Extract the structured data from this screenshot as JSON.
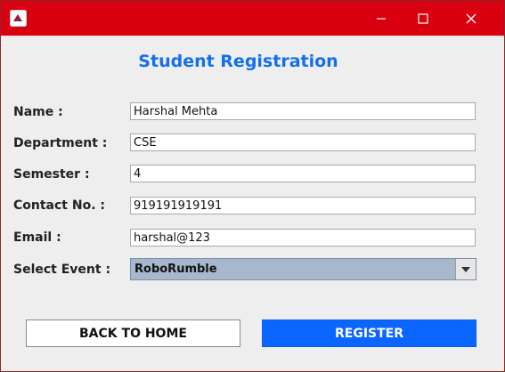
{
  "window": {
    "title_bar_color": "#d9000f",
    "controls": {
      "minimize_icon": "minimize-icon",
      "maximize_icon": "maximize-icon",
      "close_icon": "close-icon"
    }
  },
  "form": {
    "title": "Student Registration",
    "fields": [
      {
        "label": "Name :",
        "value": "Harshal Mehta"
      },
      {
        "label": "Department :",
        "value": "CSE"
      },
      {
        "label": "Semester :",
        "value": "4"
      },
      {
        "label": "Contact No. :",
        "value": "919191919191"
      },
      {
        "label": "Email :",
        "value": "harshal@123"
      }
    ],
    "event": {
      "label": "Select Event :",
      "selected": "RoboRumble"
    }
  },
  "buttons": {
    "back": "BACK TO HOME",
    "register": "REGISTER"
  },
  "colors": {
    "accent": "#1370e8",
    "register_button": "#0a66ff",
    "select_bg": "#a8b8cc"
  }
}
